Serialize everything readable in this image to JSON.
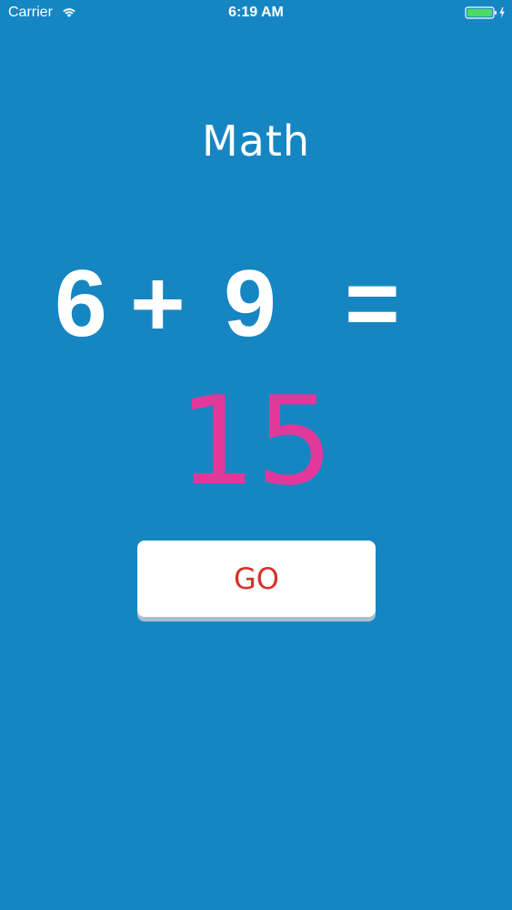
{
  "status_bar": {
    "carrier": "Carrier",
    "time": "6:19 AM",
    "battery_color": "#4cd964"
  },
  "screen": {
    "title": "Math",
    "equation": {
      "operand_a": "6",
      "operator": "+",
      "operand_b": "9",
      "equals": "="
    },
    "answer": "15",
    "go_label": "GO"
  },
  "colors": {
    "background": "#1686c3",
    "answer": "#e2389a",
    "button_text": "#d9302a"
  }
}
